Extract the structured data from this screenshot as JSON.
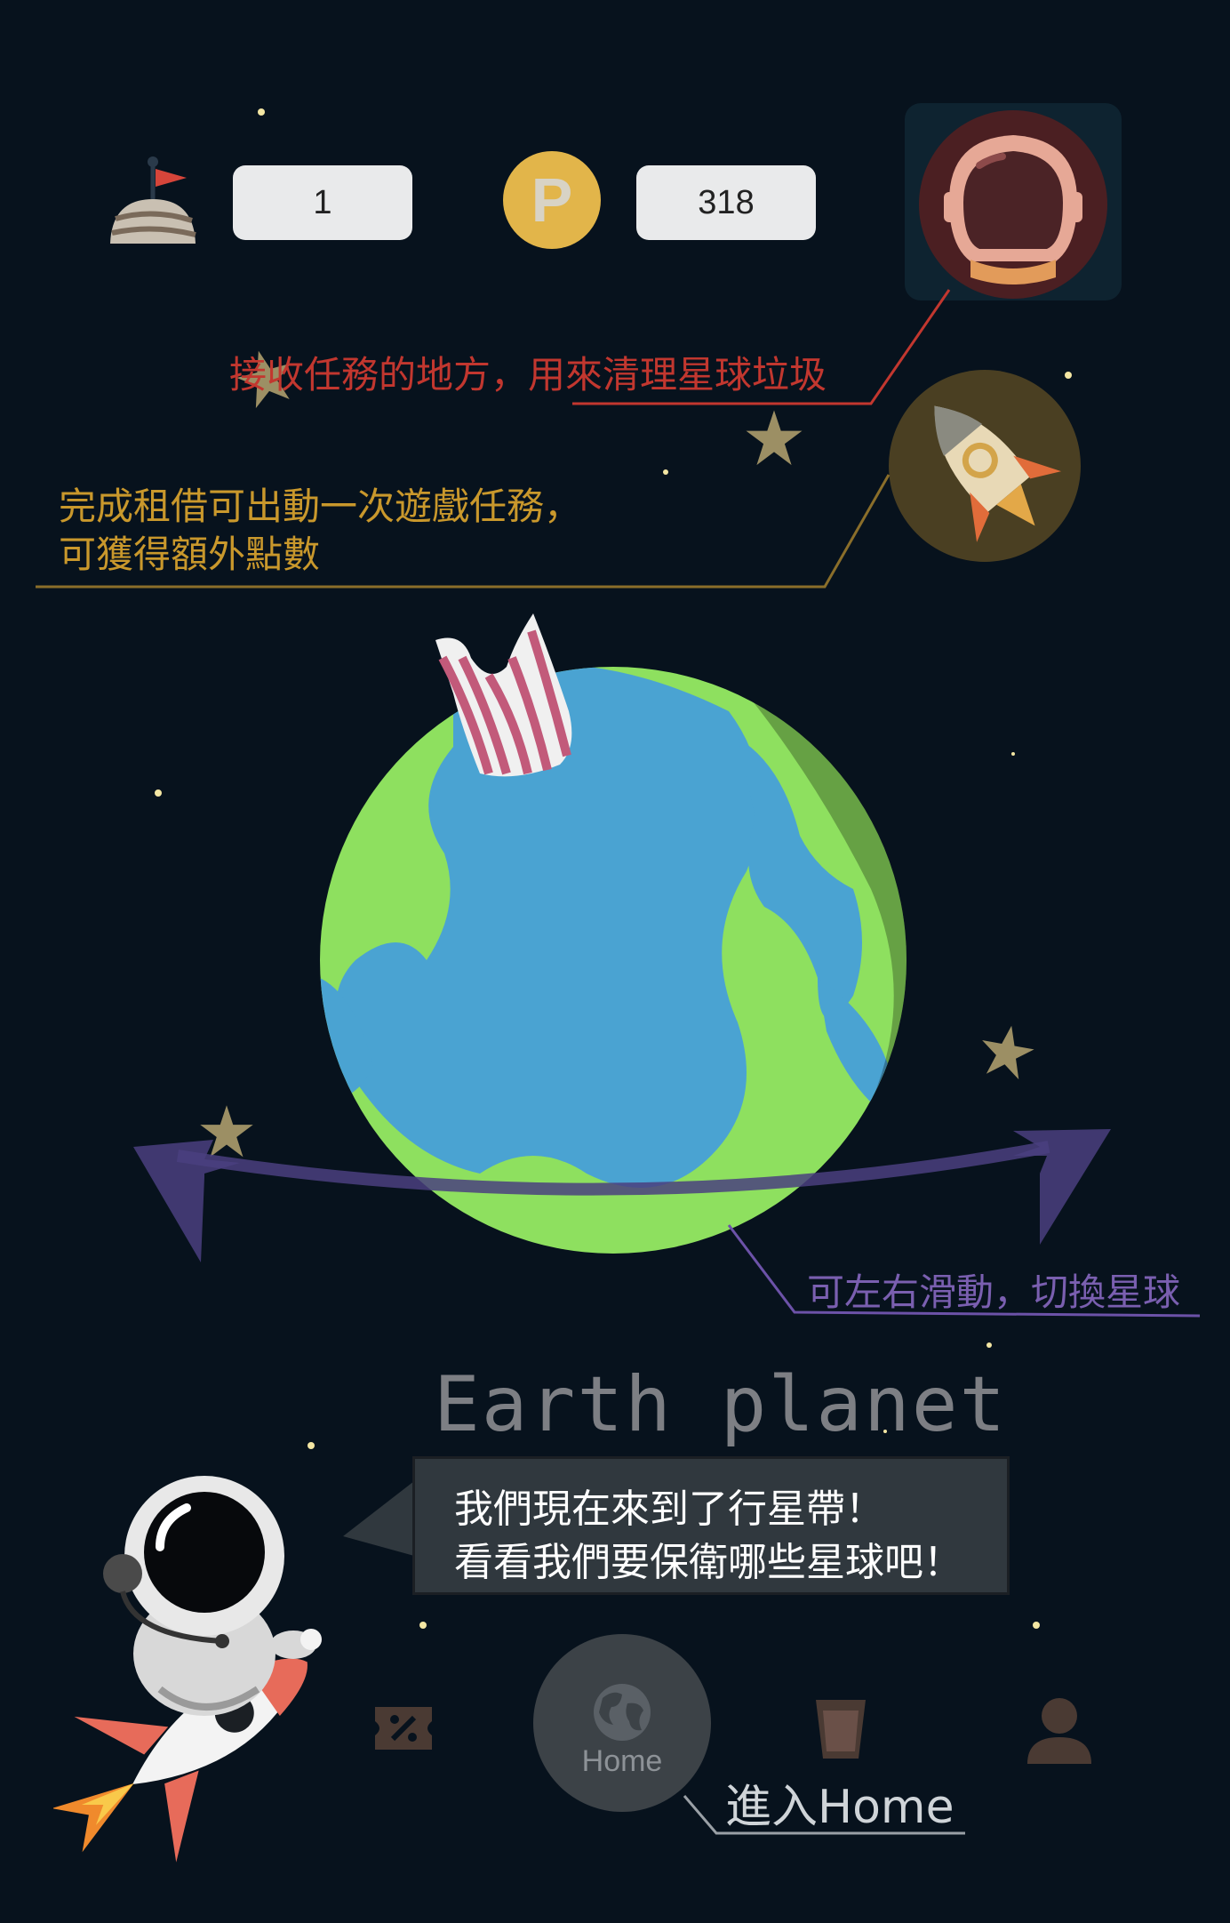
{
  "topbar": {
    "level_value": "1",
    "points_value": "318",
    "points_coin_letter": "P"
  },
  "annotations": {
    "mission": "接收任務的地方，用來清理星球垃圾",
    "rent_line1": "完成租借可出動一次遊戲任務，",
    "rent_line2": "可獲得額外點數",
    "swipe": "可左右滑動，切換星球",
    "enter_home": "進入Home"
  },
  "planet": {
    "name": "Earth planet"
  },
  "speech": {
    "line1": "我們現在來到了行星帶！",
    "line2": "看看我們要保衛哪些星球吧！"
  },
  "nav": {
    "home_label": "Home",
    "items": [
      "coupon-icon",
      "globe-icon",
      "cup-icon",
      "user-icon"
    ]
  },
  "colors": {
    "background": "#07121d",
    "mission_annotation": "#c2372f",
    "rent_annotation": "#c9982c",
    "swipe_annotation": "#7a5fb0",
    "earth_ocean": "#4aa3d2",
    "earth_land": "#8ee05f",
    "swipe_arrow": "#4a3f7f"
  }
}
